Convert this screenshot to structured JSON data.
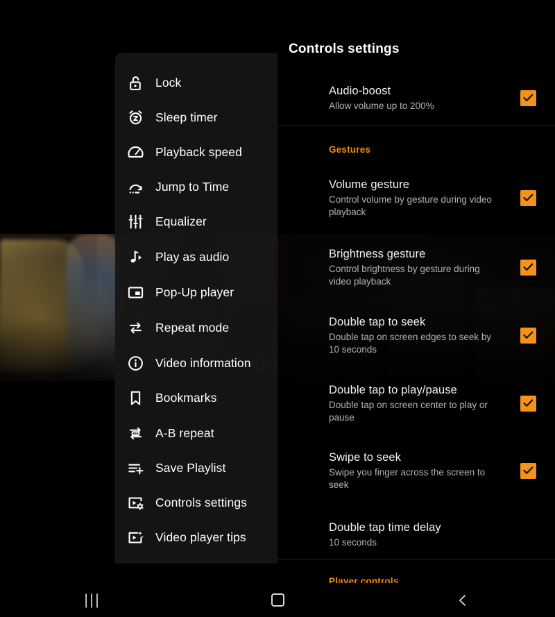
{
  "app": {
    "video_watermark": "HBO"
  },
  "menu": {
    "items": [
      {
        "label": "Lock",
        "icon": "lock-open-icon"
      },
      {
        "label": "Sleep timer",
        "icon": "sleep-timer-icon"
      },
      {
        "label": "Playback speed",
        "icon": "speedometer-icon"
      },
      {
        "label": "Jump to Time",
        "icon": "jump-to-time-icon"
      },
      {
        "label": "Equalizer",
        "icon": "equalizer-icon"
      },
      {
        "label": "Play as audio",
        "icon": "music-note-play-icon"
      },
      {
        "label": "Pop-Up player",
        "icon": "picture-in-picture-icon"
      },
      {
        "label": "Repeat mode",
        "icon": "repeat-icon"
      },
      {
        "label": "Video information",
        "icon": "info-circle-icon"
      },
      {
        "label": "Bookmarks",
        "icon": "bookmark-icon"
      },
      {
        "label": "A-B repeat",
        "icon": "ab-repeat-icon"
      },
      {
        "label": "Save Playlist",
        "icon": "playlist-add-icon"
      },
      {
        "label": "Controls settings",
        "icon": "video-settings-icon"
      },
      {
        "label": "Video player tips",
        "icon": "video-tips-icon"
      }
    ]
  },
  "settings": {
    "title": "Controls settings",
    "sections": [
      {
        "header": null,
        "rows": [
          {
            "title": "Audio-boost",
            "subtitle": "Allow volume up to 200%",
            "control": "checkbox",
            "checked": true
          }
        ]
      },
      {
        "header": "Gestures",
        "rows": [
          {
            "title": "Volume gesture",
            "subtitle": "Control volume by gesture during video playback",
            "control": "checkbox",
            "checked": true
          },
          {
            "title": "Brightness gesture",
            "subtitle": "Control brightness by gesture during video playback",
            "control": "checkbox",
            "checked": true
          },
          {
            "title": "Double tap to seek",
            "subtitle": "Double tap on screen edges to seek by 10 seconds",
            "control": "checkbox",
            "checked": true
          },
          {
            "title": "Double tap to play/pause",
            "subtitle": "Double tap on screen center to play or pause",
            "control": "checkbox",
            "checked": true
          },
          {
            "title": "Swipe to seek",
            "subtitle": "Swipe you finger across the screen to seek",
            "control": "checkbox",
            "checked": true
          },
          {
            "title": "Double tap time delay",
            "subtitle": "10 seconds",
            "control": "none",
            "checked": false
          }
        ]
      },
      {
        "header": "Player controls",
        "rows": []
      }
    ]
  },
  "navbar": {
    "recents": "|||",
    "home": "home-square-icon",
    "back": "back-chevron-icon"
  },
  "colors": {
    "accent": "#F08A0C",
    "checkbox": "#F59218",
    "panel_bg": "#151515",
    "text_primary": "#FFFFFF",
    "text_secondary": "#B3B3B3"
  }
}
